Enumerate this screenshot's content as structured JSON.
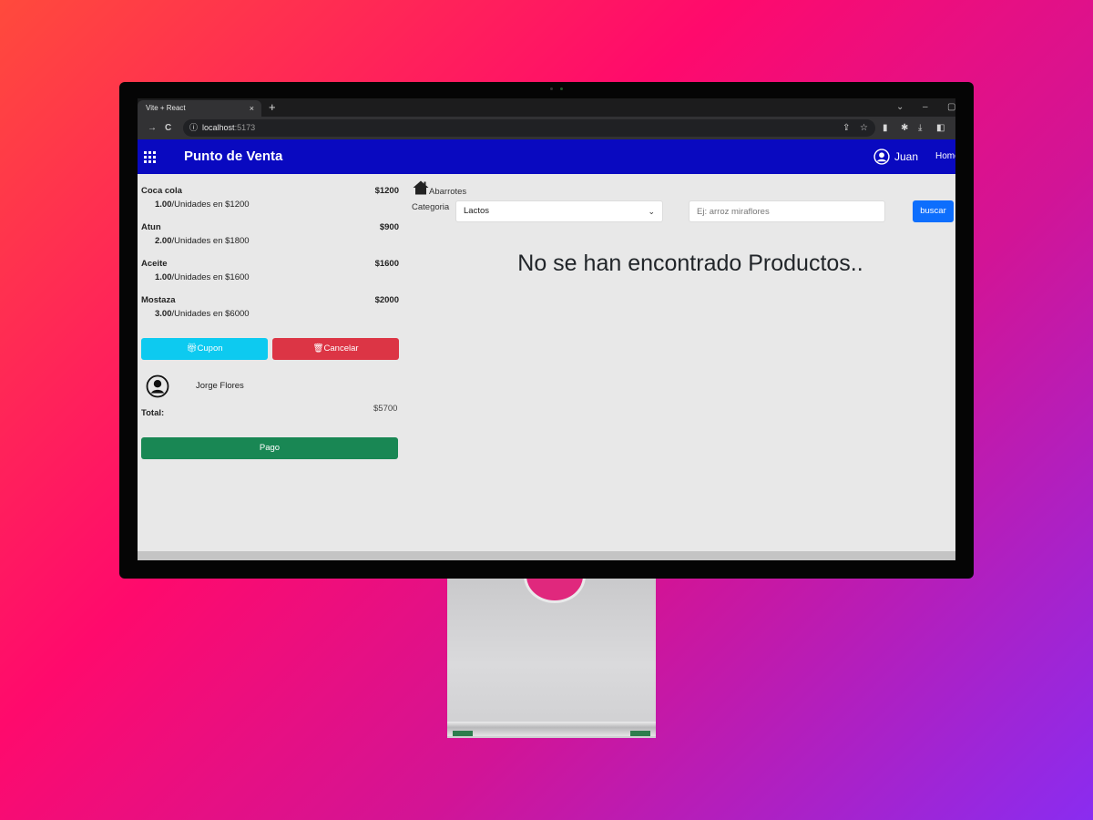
{
  "browser": {
    "tab_title": "Vite + React",
    "tab_close": "×",
    "new_tab": "+",
    "url_host": "localhost",
    "url_port": ":5173"
  },
  "navbar": {
    "brand": "Punto de Venta",
    "user": "Juan",
    "home_link": "Home",
    "colors": {
      "bar": "#0909c0"
    }
  },
  "cart": {
    "items": [
      {
        "name": "Coca cola",
        "price": "$1200",
        "qty": "1.00",
        "detail": "/Unidades en $1200"
      },
      {
        "name": "Atun",
        "price": "$900",
        "qty": "2.00",
        "detail": "/Unidades en $1800"
      },
      {
        "name": "Aceite",
        "price": "$1600",
        "qty": "1.00",
        "detail": "/Unidades en $1600"
      },
      {
        "name": "Mostaza",
        "price": "$2000",
        "qty": "3.00",
        "detail": "/Unidades en $6000"
      }
    ],
    "cupon_label": "Cupon",
    "cancel_label": "Cancelar",
    "client_name": "Jorge Flores",
    "total_label": "Total:",
    "total_value": "$5700",
    "pay_label": "Pago"
  },
  "catalog": {
    "breadcrumb": "Abarrotes",
    "category_label": "Categoria",
    "category_selected": "Lactos",
    "search_placeholder": "Ej: arroz miraflores",
    "search_button": "buscar",
    "empty_message": "No se han encontrado Productos.."
  }
}
